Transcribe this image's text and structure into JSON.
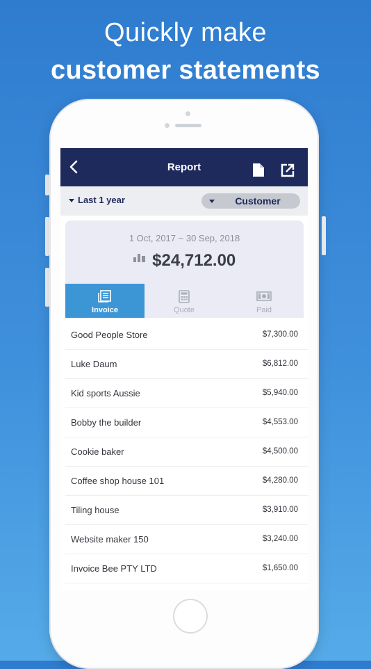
{
  "headline": {
    "line1": "Quickly make",
    "line2": "customer statements"
  },
  "nav": {
    "title": "Report",
    "back_icon": "chevron-left-icon",
    "document_icon": "document-icon",
    "export_icon": "export-icon"
  },
  "filter": {
    "period": "Last 1 year",
    "group_by": "Customer"
  },
  "summary": {
    "date_range": "1 Oct, 2017 ~ 30 Sep, 2018",
    "total": "$24,712.00",
    "icon": "bar-chart-icon"
  },
  "tabs": [
    {
      "label": "Invoice",
      "icon": "invoice-icon",
      "active": true
    },
    {
      "label": "Quote",
      "icon": "calculator-icon",
      "active": false
    },
    {
      "label": "Paid",
      "icon": "cash-icon",
      "active": false
    }
  ],
  "customers": [
    {
      "name": "Good People Store",
      "amount": "$7,300.00"
    },
    {
      "name": "Luke Daum",
      "amount": "$6,812.00"
    },
    {
      "name": "Kid sports Aussie",
      "amount": "$5,940.00"
    },
    {
      "name": "Bobby the builder",
      "amount": "$4,553.00"
    },
    {
      "name": "Cookie baker",
      "amount": "$4,500.00"
    },
    {
      "name": "Coffee shop house 101",
      "amount": "$4,280.00"
    },
    {
      "name": "Tiling house",
      "amount": "$3,910.00"
    },
    {
      "name": "Website maker 150",
      "amount": "$3,240.00"
    },
    {
      "name": "Invoice Bee PTY LTD",
      "amount": "$1,650.00"
    }
  ],
  "colors": {
    "nav": "#1e2a5c",
    "active_tab": "#3c96d6",
    "background": "#2f7ccf"
  }
}
